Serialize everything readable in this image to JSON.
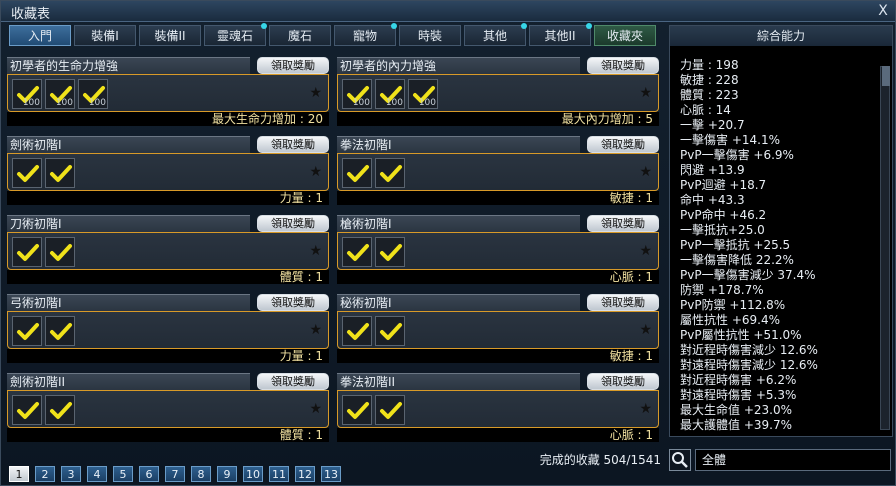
{
  "window": {
    "title": "收藏表",
    "close_glyph": "X"
  },
  "tabs": [
    {
      "label": "入門",
      "active": true,
      "dot": false
    },
    {
      "label": "裝備I",
      "active": false,
      "dot": false
    },
    {
      "label": "裝備II",
      "active": false,
      "dot": false
    },
    {
      "label": "靈魂石",
      "active": false,
      "dot": true
    },
    {
      "label": "魔石",
      "active": false,
      "dot": false
    },
    {
      "label": "寵物",
      "active": false,
      "dot": true
    },
    {
      "label": "時裝",
      "active": false,
      "dot": false
    },
    {
      "label": "其他",
      "active": false,
      "dot": true
    },
    {
      "label": "其他II",
      "active": false,
      "dot": true
    },
    {
      "label": "收藏夾",
      "active": false,
      "dot": false
    }
  ],
  "claim_label": "領取獎勵",
  "cards": [
    {
      "title": "初學者的生命力增強",
      "bonus": "最大生命力增加 : 20",
      "slots": [
        {
          "check": true,
          "count": "100",
          "item": "potion"
        },
        {
          "check": true,
          "count": "100",
          "item": "potion"
        },
        {
          "check": true,
          "count": "100",
          "item": "potion"
        }
      ]
    },
    {
      "title": "初學者的內力增強",
      "bonus": "最大內力增加 : 5",
      "slots": [
        {
          "check": true,
          "count": "100",
          "item": "potion"
        },
        {
          "check": true,
          "count": "100",
          "item": "potion"
        },
        {
          "check": true,
          "count": "100",
          "item": "potion"
        }
      ]
    },
    {
      "title": "劍術初階I",
      "bonus": "力量 : 1",
      "slots": [
        {
          "check": true,
          "count": "",
          "item": "sword"
        },
        {
          "check": true,
          "count": "",
          "item": "sword"
        }
      ]
    },
    {
      "title": "拳法初階I",
      "bonus": "敏捷 : 1",
      "slots": [
        {
          "check": true,
          "count": "",
          "item": "glove"
        },
        {
          "check": true,
          "count": "",
          "item": "glove"
        }
      ]
    },
    {
      "title": "刀術初階I",
      "bonus": "體質 : 1",
      "slots": [
        {
          "check": true,
          "count": "",
          "item": "blade"
        },
        {
          "check": true,
          "count": "",
          "item": "blade"
        }
      ]
    },
    {
      "title": "槍術初階I",
      "bonus": "心脈 : 1",
      "slots": [
        {
          "check": true,
          "count": "",
          "item": "spear"
        },
        {
          "check": true,
          "count": "",
          "item": "spear"
        }
      ]
    },
    {
      "title": "弓術初階I",
      "bonus": "力量 : 1",
      "slots": [
        {
          "check": true,
          "count": "",
          "item": "bow"
        },
        {
          "check": true,
          "count": "",
          "item": "bow"
        }
      ]
    },
    {
      "title": "秘術初階I",
      "bonus": "敏捷 : 1",
      "slots": [
        {
          "check": true,
          "count": "",
          "item": "orb"
        },
        {
          "check": true,
          "count": "",
          "item": "orb"
        }
      ]
    },
    {
      "title": "劍術初階II",
      "bonus": "體質 : 1",
      "slots": [
        {
          "check": true,
          "count": "",
          "item": "sword"
        },
        {
          "check": true,
          "count": "",
          "item": "sword"
        }
      ]
    },
    {
      "title": "拳法初階II",
      "bonus": "心脈 : 1",
      "slots": [
        {
          "check": true,
          "count": "",
          "item": "glove"
        },
        {
          "check": true,
          "count": "",
          "item": "glove"
        }
      ]
    }
  ],
  "progress_text": "完成的收藏 504/1541",
  "pages": [
    "1",
    "2",
    "3",
    "4",
    "5",
    "6",
    "7",
    "8",
    "9",
    "10",
    "11",
    "12",
    "13"
  ],
  "active_page": "1",
  "side_panel": {
    "title": "綜合能力",
    "stats": [
      "力量 : 198",
      "敏捷 : 228",
      "體質 : 223",
      "心脈 : 14",
      "一擊 +20.7",
      "一擊傷害 +14.1%",
      "PvP一擊傷害 +6.9%",
      "閃避 +13.9",
      "PvP迴避 +18.7",
      "命中 +43.3",
      "PvP命中 +46.2",
      "一擊抵抗+25.0",
      "PvP一擊抵抗 +25.5",
      "一擊傷害降低 22.2%",
      "PvP一擊傷害減少 37.4%",
      "防禦 +178.7%",
      "PvP防禦 +112.8%",
      "屬性抗性 +69.4%",
      "PvP屬性抗性 +51.0%",
      "對近程時傷害減少 12.6%",
      "對遠程時傷害減少 12.6%",
      "對近程時傷害 +6.2%",
      "對遠程時傷害 +5.3%",
      "最大生命值 +23.0%",
      "最大護體值 +39.7%"
    ]
  },
  "filter": {
    "value": "全體"
  },
  "colors": {
    "accent_border": "#d89a28",
    "check": "#f0e21a",
    "tab_dot": "#37d6e8"
  }
}
